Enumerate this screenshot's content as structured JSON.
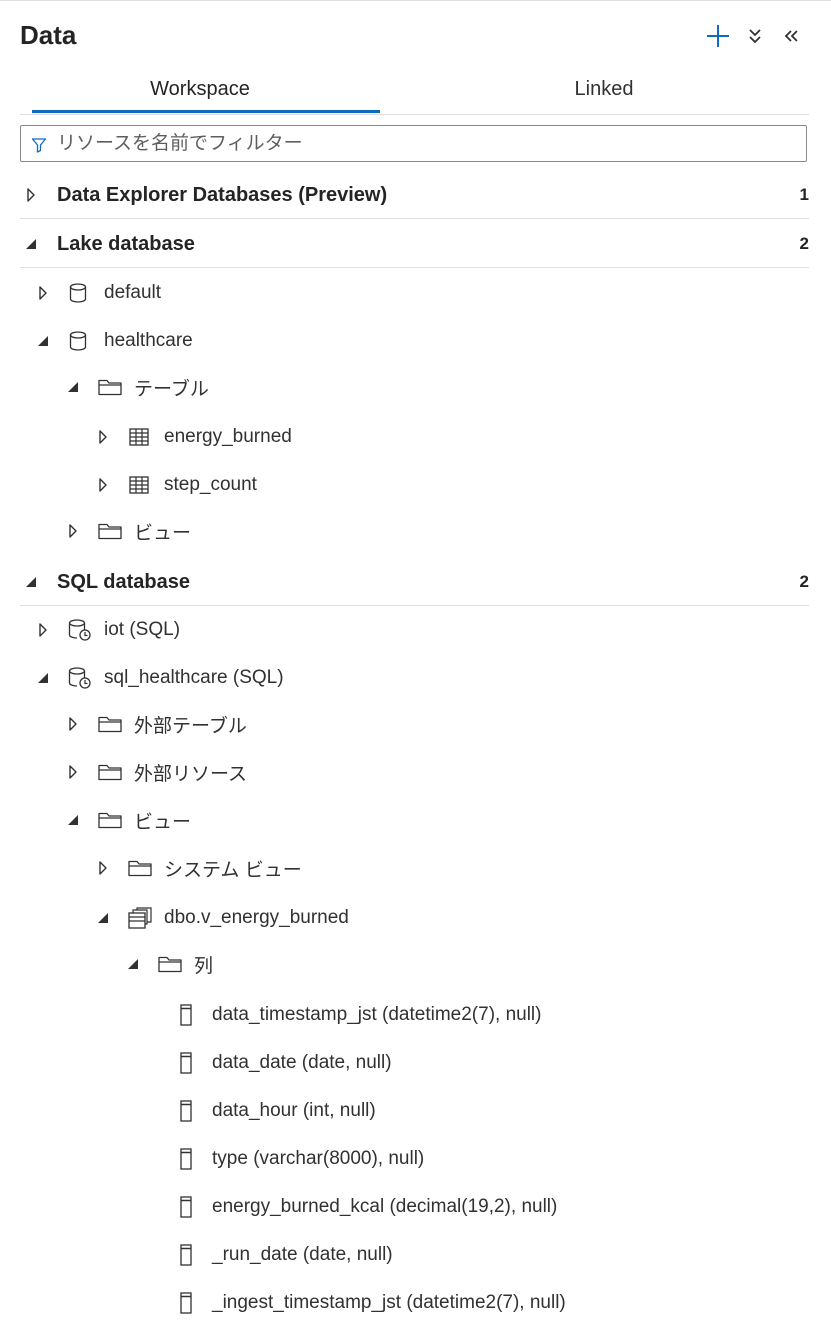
{
  "header": {
    "title": "Data"
  },
  "tabs": [
    {
      "label": "Workspace",
      "active": true
    },
    {
      "label": "Linked",
      "active": false
    }
  ],
  "filter": {
    "placeholder": "リソースを名前でフィルター",
    "value": ""
  },
  "sections": {
    "data_explorer": {
      "label": "Data Explorer Databases (Preview)",
      "count": "1",
      "expanded": false
    },
    "lake": {
      "label": "Lake database",
      "count": "2",
      "expanded": true
    },
    "sql": {
      "label": "SQL database",
      "count": "2",
      "expanded": true
    }
  },
  "lake_tree": {
    "default": "default",
    "healthcare": "healthcare",
    "tables_folder": "テーブル",
    "energy_burned": "energy_burned",
    "step_count": "step_count",
    "views_folder": "ビュー"
  },
  "sql_tree": {
    "iot": "iot (SQL)",
    "sql_healthcare": "sql_healthcare (SQL)",
    "external_tables": "外部テーブル",
    "external_resources": "外部リソース",
    "views_folder": "ビュー",
    "system_views": "システム ビュー",
    "view_name": "dbo.v_energy_burned",
    "columns_folder": "列",
    "columns": [
      "data_timestamp_jst (datetime2(7), null)",
      "data_date (date, null)",
      "data_hour (int, null)",
      "type (varchar(8000), null)",
      "energy_burned_kcal (decimal(19,2), null)",
      "_run_date (date, null)",
      "_ingest_timestamp_jst (datetime2(7), null)"
    ]
  },
  "colors": {
    "accent": "#0f6cbd",
    "text": "#242424",
    "divider": "#e1dfdd"
  }
}
